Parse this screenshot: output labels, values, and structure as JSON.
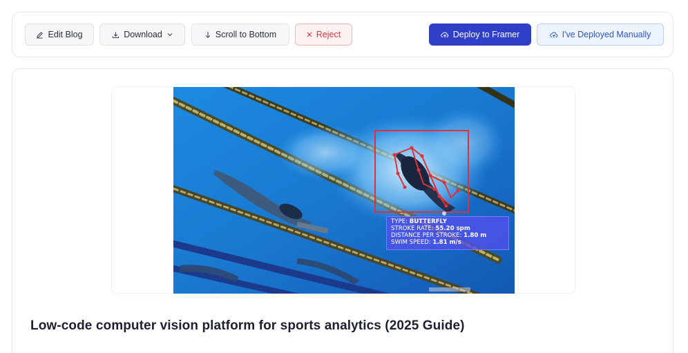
{
  "toolbar": {
    "edit_label": "Edit Blog",
    "download_label": "Download",
    "scroll_label": "Scroll to Bottom",
    "reject_label": "Reject",
    "deploy_label": "Deploy to Framer",
    "manual_label": "I've Deployed Manually"
  },
  "icons": {
    "edit": "pencil-icon",
    "download": "download-icon",
    "dropdown": "chevron-down-icon",
    "scroll": "arrow-down-icon",
    "reject": "close-icon",
    "deploy": "cloud-upload-icon",
    "manual": "cloud-upload-icon"
  },
  "colors": {
    "primary": "#2f3fc7",
    "reject": "#d63b3b",
    "outline_text": "#2f56c8",
    "pool": "#1d7fd6",
    "detection_box": "#e0303a",
    "overlay": "#5050eb"
  },
  "article": {
    "title": "Low-code computer vision platform for sports analytics (2025 Guide)",
    "image_overlay": {
      "type_label": "TYPE: ",
      "type_value": "BUTTERFLY",
      "rate_label": "STROKE RATE: ",
      "rate_value": "55.20 spm",
      "dps_label": "DISTANCE PER STROKE: ",
      "dps_value": "1.80 m",
      "speed_label": "SWIM SPEED: ",
      "speed_value": "1.81 m/s"
    }
  }
}
